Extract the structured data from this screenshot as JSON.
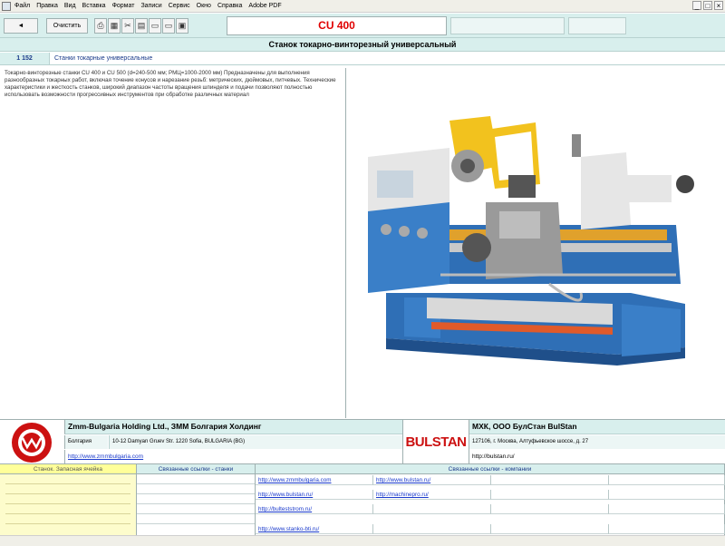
{
  "menu": [
    "Файл",
    "Правка",
    "Вид",
    "Вставка",
    "Формат",
    "Записи",
    "Сервис",
    "Окно",
    "Справка",
    "Adobe PDF"
  ],
  "window_controls": [
    "_",
    "□",
    "×"
  ],
  "toolbar": {
    "back_icon": "back-arrow-icon",
    "back_symbol": "◄",
    "clear_label": "Очистить",
    "icons": [
      {
        "name": "print-icon",
        "symbol": "⎙"
      },
      {
        "name": "calculator-icon",
        "symbol": "▦"
      },
      {
        "name": "tools-icon",
        "symbol": "✂"
      },
      {
        "name": "document-icon",
        "symbol": "▤"
      },
      {
        "name": "page-icon",
        "symbol": "▭"
      },
      {
        "name": "page-icon-2",
        "symbol": "▭"
      },
      {
        "name": "settings-icon",
        "symbol": "▣"
      }
    ],
    "model": "CU 400"
  },
  "title": "Станок токарно-винторезный универсальный",
  "category": {
    "code": "1 152",
    "name": "Станки токарные универсальные"
  },
  "description": "Токарно-винторезные станки CU 400 и CU 500 (d=240-500 мм; РМЦ=1000-2000 мм) Предназначены для выполнения разнообразных токарных работ, включая точение конусов и нарезание резьб: метрических, дюймовых, питчевых. Технические характеристики и жесткость станков, широкий диапазон частоты вращения шпинделя и подачи позволяют полностью использовать возможности прогрессивных инструментов при обработке различных материал",
  "company1": {
    "name": "Zmm-Bulgaria Holding Ltd., ЗММ Болгария Холдинг",
    "country": "Болгария",
    "address": "10-12 Damyan Gruev Str. 1220 Sofia, BULGARIA (BG)",
    "url": "http://www.zmmbulgaria.com"
  },
  "company2": {
    "logo_text": "BULSTAN",
    "name": "МХК, ООО  БулСтан  BulStan",
    "address": "127106, г. Москва, Алтуфьевское шоссе, д. 27",
    "url": "http://bulstan.ru/"
  },
  "links": {
    "machines_header": "Станок. Запасная ячейка",
    "related_header": "Связанные ссылки - станки",
    "companies_header": "Связанные ссылки - компании",
    "left_links": [
      "http://www.zmmbulgaria.com",
      "http://www.bulstan.ru/",
      "http://bulteststrom.ru/",
      "http://www.stanko-bti.ru/"
    ],
    "right_links": [
      "http://www.bulstan.ru/",
      "http://machinepro.ru/"
    ]
  },
  "colors": {
    "accent": "#d8efed",
    "model_text": "#e00000",
    "link": "#1a3acc",
    "panel_yellow": "#fdfccc"
  }
}
